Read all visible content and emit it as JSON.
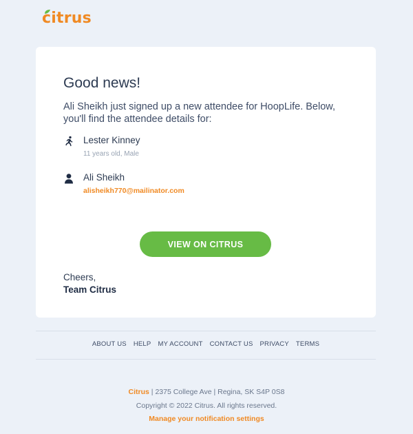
{
  "header": {
    "logo_text": "citrus",
    "brand_color": "#f08a24",
    "leaf_color": "#67bb45"
  },
  "card": {
    "headline": "Good news!",
    "intro": "Ali Sheikh just signed up a new attendee for HoopLife. Below, you'll find the attendee details for:",
    "attendee": {
      "icon": "running-person-icon",
      "name": "Lester Kinney",
      "details": "11 years old, Male"
    },
    "registrant": {
      "icon": "user-icon",
      "name": "Ali Sheikh",
      "email": "alisheikh770@mailinator.com"
    },
    "cta_label": "VIEW ON CITRUS",
    "cta_color": "#67bb45",
    "signoff_line": "Cheers,",
    "signoff_team": "Team Citrus"
  },
  "footer": {
    "nav": [
      "ABOUT US",
      "HELP",
      "MY ACCOUNT",
      "CONTACT US",
      "PRIVACY",
      "TERMS"
    ],
    "brand": "Citrus",
    "address": " | 2375 College Ave | Regina, SK S4P 0S8",
    "copyright": "Copyright © 2022 Citrus. All rights reserved.",
    "manage_link": "Manage your notification settings"
  }
}
